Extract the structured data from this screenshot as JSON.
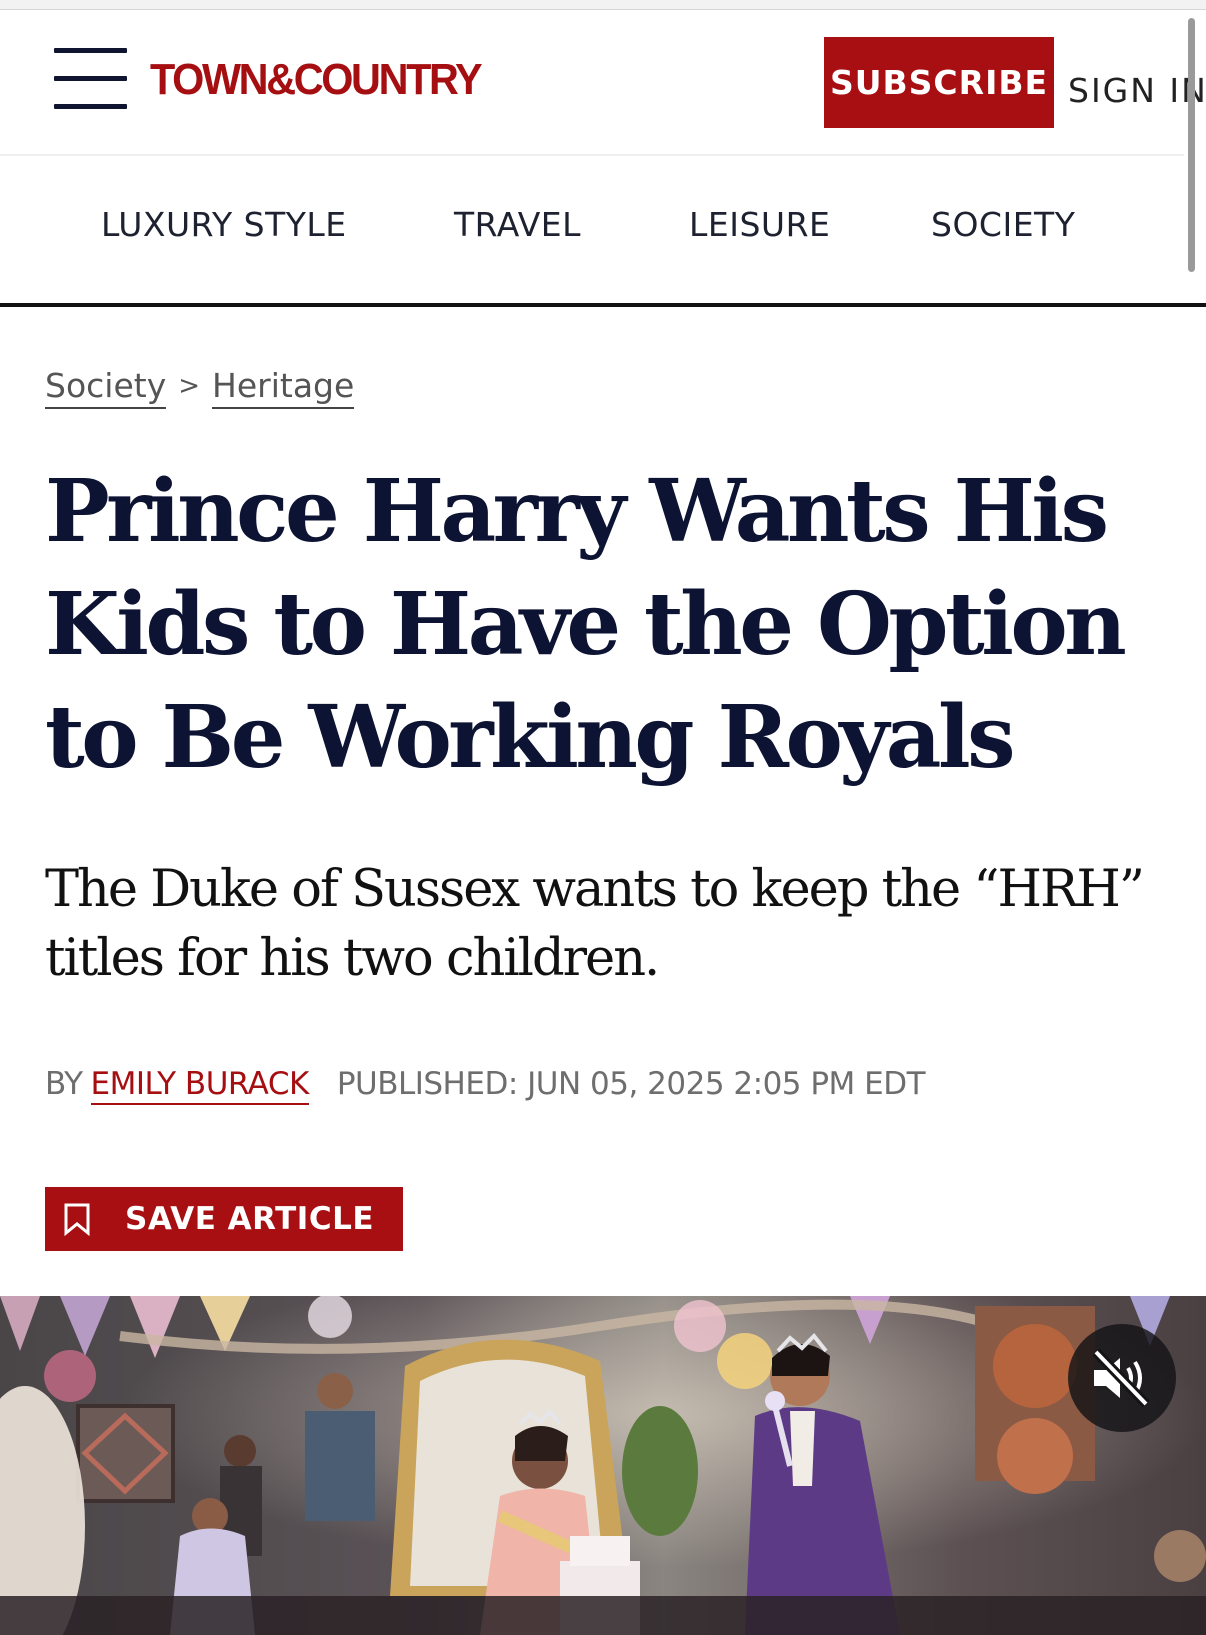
{
  "header": {
    "logo": "TOWN&COUNTRY",
    "subscribe_label": "SUBSCRIBE",
    "signin_label": "SIGN IN",
    "menu_icon": "hamburger-menu-icon"
  },
  "nav": {
    "items": [
      {
        "label": "LUXURY STYLE"
      },
      {
        "label": "TRAVEL"
      },
      {
        "label": "LEISURE"
      },
      {
        "label": "SOCIETY"
      }
    ]
  },
  "breadcrumb": {
    "items": [
      {
        "label": "Society"
      },
      {
        "label": "Heritage"
      }
    ],
    "separator": ">"
  },
  "article": {
    "headline": "Prince Harry Wants His Kids to Have the Option to Be Working Royals",
    "dek": "The Duke of Sussex wants to keep the “HRH” titles for his two children.",
    "byline_prefix": "BY",
    "author": "EMILY BURACK",
    "published": "PUBLISHED: JUN 05, 2025 2:05 PM EDT",
    "save_label": "SAVE ARTICLE",
    "save_icon": "bookmark-icon"
  },
  "video": {
    "mute_icon": "muted-speaker-icon"
  },
  "colors": {
    "brand_red": "#a80f12",
    "headline_navy": "#0d1332"
  }
}
